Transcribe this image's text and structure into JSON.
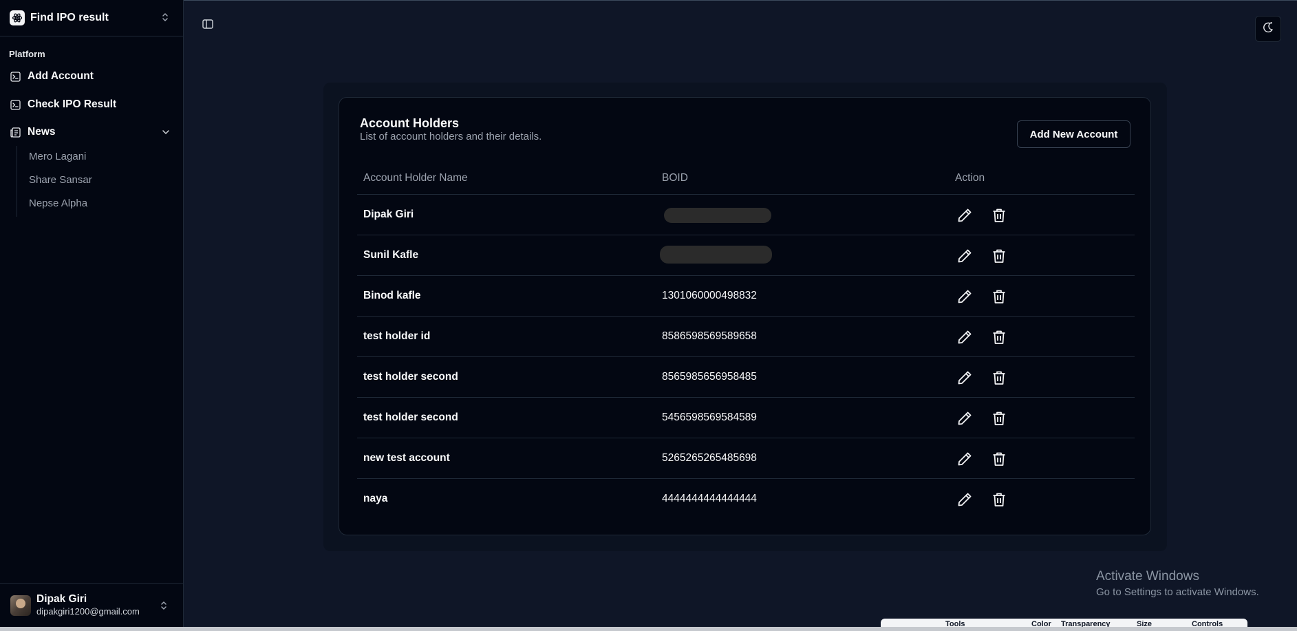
{
  "app": {
    "title": "Find IPO result"
  },
  "sidebar": {
    "section_label": "Platform",
    "items": [
      {
        "label": "Add Account",
        "icon": "terminal-square-icon"
      },
      {
        "label": "Check IPO Result",
        "icon": "terminal-square-icon"
      },
      {
        "label": "News",
        "icon": "newspaper-icon"
      }
    ],
    "news_subitems": [
      "Mero Lagani",
      "Share Sansar",
      "Nepse Alpha"
    ]
  },
  "user": {
    "name": "Dipak Giri",
    "email": "dipakgiri1200@gmail.com"
  },
  "card": {
    "title": "Account Holders",
    "description": "List of account holders and their details.",
    "add_button": "Add New Account",
    "columns": [
      "Account Holder Name",
      "BOID",
      "Action"
    ],
    "rows": [
      {
        "name": "Dipak Giri",
        "boid": ""
      },
      {
        "name": "Sunil Kafle",
        "boid": ""
      },
      {
        "name": "Binod kafle",
        "boid": "1301060000498832"
      },
      {
        "name": "test holder id",
        "boid": "8586598569589658"
      },
      {
        "name": "test holder second",
        "boid": "8565985656958485"
      },
      {
        "name": "test holder second",
        "boid": "5456598569584589"
      },
      {
        "name": "new test account",
        "boid": "5265265265485698"
      },
      {
        "name": "naya",
        "boid": "4444444444444444"
      }
    ]
  },
  "windows_activation": {
    "title": "Activate Windows",
    "subtitle": "Go to Settings to activate Windows."
  },
  "tools_bar": {
    "labels": [
      "Tools",
      "Color",
      "Transparency",
      "Size",
      "Controls"
    ]
  }
}
